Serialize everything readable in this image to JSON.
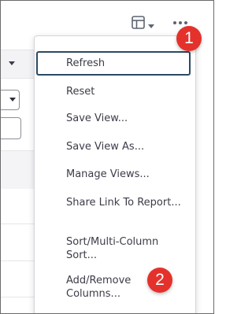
{
  "toolbar": {
    "table_icon": "table-layout-icon",
    "caret_icon": "caret-down-icon",
    "more_icon": "more-horizontal-icon"
  },
  "menu": {
    "items": [
      {
        "label": "Refresh",
        "selected": true
      },
      {
        "label": "Reset"
      },
      {
        "label": "Save View..."
      },
      {
        "label": "Save View As..."
      },
      {
        "label": "Manage Views..."
      },
      {
        "label": "Share Link To Report..."
      },
      {
        "label": "Sort/Multi-Column Sort..."
      },
      {
        "label": "Add/Remove Columns..."
      }
    ]
  },
  "callouts": {
    "one": "1",
    "two": "2"
  },
  "colors": {
    "callout": "#e5312b",
    "selected_border": "#2c4a63",
    "menu_text": "#3c3c48"
  }
}
